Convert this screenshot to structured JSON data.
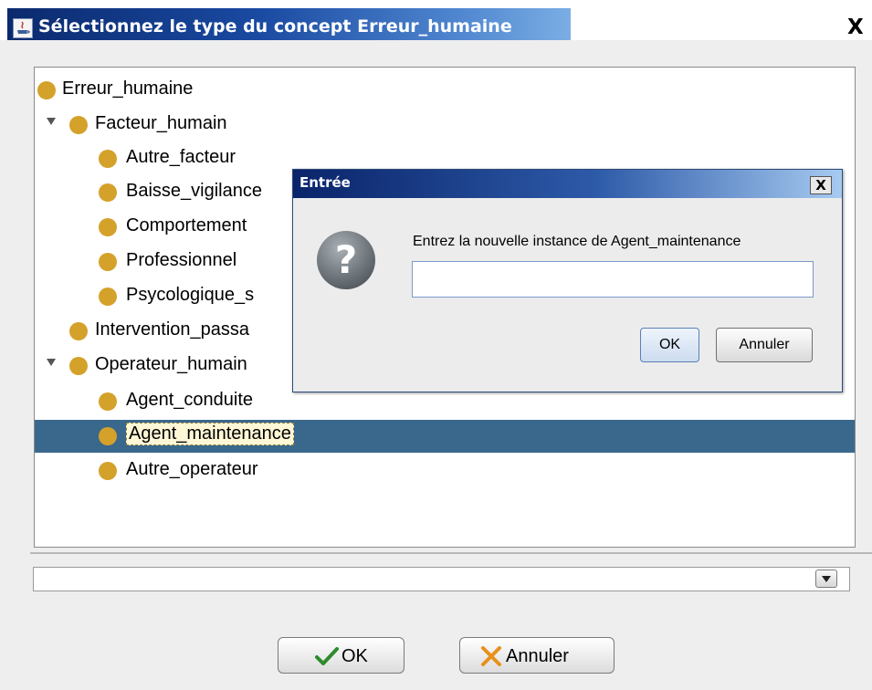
{
  "window": {
    "title": "Sélectionnez le type du concept Erreur_humaine",
    "close_glyph": "X",
    "app_icon": "java-icon"
  },
  "tree": {
    "nodes": [
      {
        "label": "Erreur_humaine",
        "level": 0,
        "expanded": null,
        "selected": false
      },
      {
        "label": "Facteur_humain",
        "level": 1,
        "expanded": true,
        "selected": false
      },
      {
        "label": "Autre_facteur",
        "level": 2,
        "expanded": null,
        "selected": false
      },
      {
        "label": "Baisse_vigilance",
        "level": 2,
        "expanded": null,
        "selected": false
      },
      {
        "label": "Comportement",
        "level": 2,
        "expanded": null,
        "selected": false
      },
      {
        "label": "Professionnel",
        "level": 2,
        "expanded": null,
        "selected": false
      },
      {
        "label": "Psycologique_s",
        "level": 2,
        "expanded": null,
        "selected": false
      },
      {
        "label": "Intervention_passa",
        "level": 1,
        "expanded": null,
        "selected": false
      },
      {
        "label": "Operateur_humain",
        "level": 1,
        "expanded": true,
        "selected": false
      },
      {
        "label": "Agent_conduite",
        "level": 2,
        "expanded": null,
        "selected": false
      },
      {
        "label": "Agent_maintenance",
        "level": 2,
        "expanded": null,
        "selected": true
      },
      {
        "label": "Autre_operateur",
        "level": 2,
        "expanded": null,
        "selected": false
      }
    ],
    "node_color": "#d4a12a",
    "selection_color": "#3a688c"
  },
  "combo": {
    "value": ""
  },
  "buttons": {
    "ok": {
      "label": "OK",
      "icon": "checkmark-icon"
    },
    "cancel": {
      "label": "Annuler",
      "icon": "cross-icon"
    }
  },
  "dialog": {
    "title": "Entrée",
    "close_glyph": "X",
    "prompt": "Entrez la nouvelle instance de Agent_maintenance",
    "input_value": "",
    "icon": "question-icon",
    "question_glyph": "?",
    "ok_label": "OK",
    "cancel_label": "Annuler"
  }
}
